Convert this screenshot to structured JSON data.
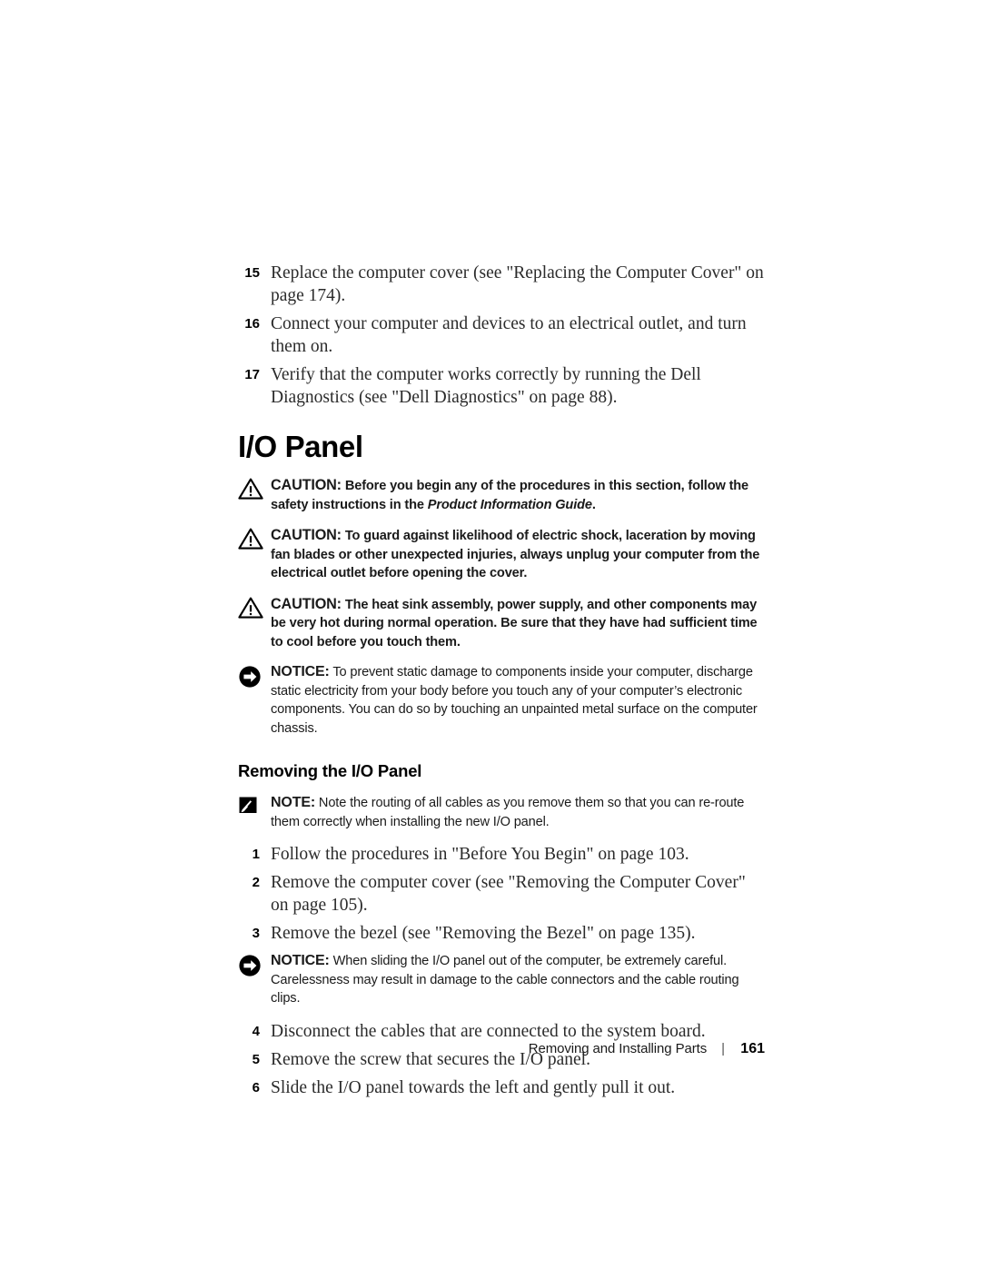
{
  "document": {
    "page_number": "161",
    "footer_title": "Removing and Installing Parts",
    "footer_divider": "|"
  },
  "top_steps": [
    {
      "num": "15",
      "text": "Replace the computer cover (see \"Replacing the Computer Cover\" on page 174)."
    },
    {
      "num": "16",
      "text": "Connect your computer and devices to an electrical outlet, and turn them on."
    },
    {
      "num": "17",
      "text": "Verify that the computer works correctly by running the Dell Diagnostics (see \"Dell Diagnostics\" on page 88)."
    }
  ],
  "section": {
    "heading": "I/O Panel",
    "subheading": "Removing the I/O Panel"
  },
  "cautions": [
    {
      "icon": "warning-triangle-icon",
      "label": "CAUTION:",
      "text_before": " Before you begin any of the procedures in this section, follow the safety instructions in the ",
      "italic": "Product Information Guide",
      "text_after": "."
    },
    {
      "icon": "warning-triangle-icon",
      "label": "CAUTION:",
      "text_before": " To guard against likelihood of electric shock, laceration by moving fan blades or other unexpected injuries, always unplug your computer from the electrical outlet before opening the cover.",
      "italic": "",
      "text_after": ""
    },
    {
      "icon": "warning-triangle-icon",
      "label": "CAUTION:",
      "text_before": " The heat sink assembly, power supply, and other components may be very hot during normal operation. Be sure that they have had sufficient time to cool before you touch them.",
      "italic": "",
      "text_after": ""
    }
  ],
  "notice_static": {
    "icon": "arrow-circle-icon",
    "label": "NOTICE:",
    "text": " To prevent static damage to components inside your computer, discharge static electricity from your body before you touch any of your computer’s electronic components. You can do so by touching an unpainted metal surface on the computer chassis."
  },
  "note_cables": {
    "icon": "note-pencil-icon",
    "label": "NOTE:",
    "text": " Note the routing of all cables as you remove them so that you can re-route them correctly when installing the new I/O panel."
  },
  "removal_steps_first": [
    {
      "num": "1",
      "text": "Follow the procedures in \"Before You Begin\" on page 103."
    },
    {
      "num": "2",
      "text": "Remove the computer cover (see \"Removing the Computer Cover\" on page 105)."
    },
    {
      "num": "3",
      "text": "Remove the bezel (see \"Removing the Bezel\" on page 135)."
    }
  ],
  "notice_sliding": {
    "icon": "arrow-circle-icon",
    "label": "NOTICE:",
    "text": " When sliding the I/O panel out of the computer, be extremely careful. Carelessness may result in damage to the cable connectors and the cable routing clips."
  },
  "removal_steps_second": [
    {
      "num": "4",
      "text": "Disconnect the cables that are connected to the system board."
    },
    {
      "num": "5",
      "text": "Remove the screw that secures the I/O panel."
    },
    {
      "num": "6",
      "text": "Slide the I/O panel towards the left and gently pull it out."
    }
  ],
  "colors": {
    "page_background": "#ffffff",
    "body_text": "#2b2b2b",
    "heading_text": "#000000",
    "bold_sans_text": "#1a1a1a"
  }
}
